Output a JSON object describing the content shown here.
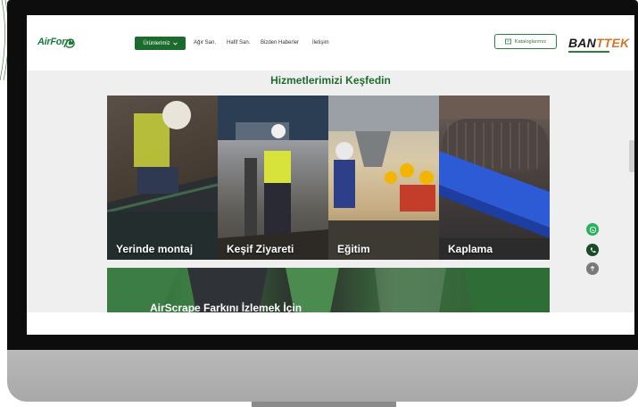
{
  "header": {
    "logo_text": "AirForm",
    "nav": {
      "products_label": "Ürünlerimiz",
      "links": [
        "Ağır San.",
        "Hafif San.",
        "Bizden Haberler",
        "İletişim"
      ]
    },
    "catalog_label": "Kataloglarımız",
    "brand": {
      "part1": "BAN",
      "part2": "TTEK"
    }
  },
  "section_title": "Hizmetlerimizi Keşfedin",
  "cards": [
    {
      "label": "Yerinde montaj"
    },
    {
      "label": "Keşif Ziyareti"
    },
    {
      "label": "Eğitim"
    },
    {
      "label": "Kaplama"
    }
  ],
  "banner_text": "AirScrape Farkını İzlemek İçin",
  "colors": {
    "brand_green": "#1b6b2e",
    "title_green": "#1e6b30",
    "brand_accent": "#d4762a"
  },
  "icons": [
    "whatsapp-icon",
    "phone-icon",
    "arrow-up-icon",
    "chevron-down-icon",
    "catalog-icon"
  ]
}
